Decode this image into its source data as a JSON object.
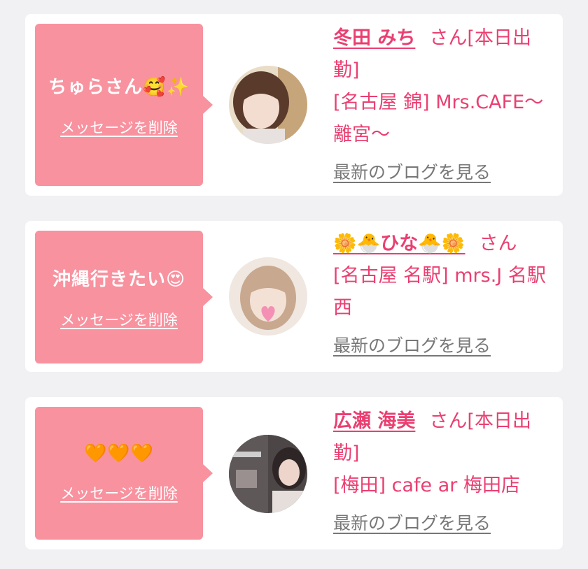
{
  "cards": [
    {
      "message": "ちゅらさん🥰✨",
      "delete_label": "メッセージを削除",
      "name": "冬田 みち",
      "honorific": "さん[本日出勤]",
      "shop": "[名古屋 錦] Mrs.CAFE～離宮～",
      "blog_label": "最新のブログを見る"
    },
    {
      "message": "沖縄行きたい😍",
      "delete_label": "メッセージを削除",
      "name": "🌼🐣ひな🐣🌼",
      "honorific": "さん",
      "shop": "[名古屋 名駅] mrs.J 名駅西",
      "blog_label": "最新のブログを見る"
    },
    {
      "message": "🧡🧡🧡",
      "delete_label": "メッセージを削除",
      "name": "広瀬 海美",
      "honorific": "さん[本日出勤]",
      "shop": "[梅田] cafe ar 梅田店",
      "blog_label": "最新のブログを見る"
    }
  ]
}
